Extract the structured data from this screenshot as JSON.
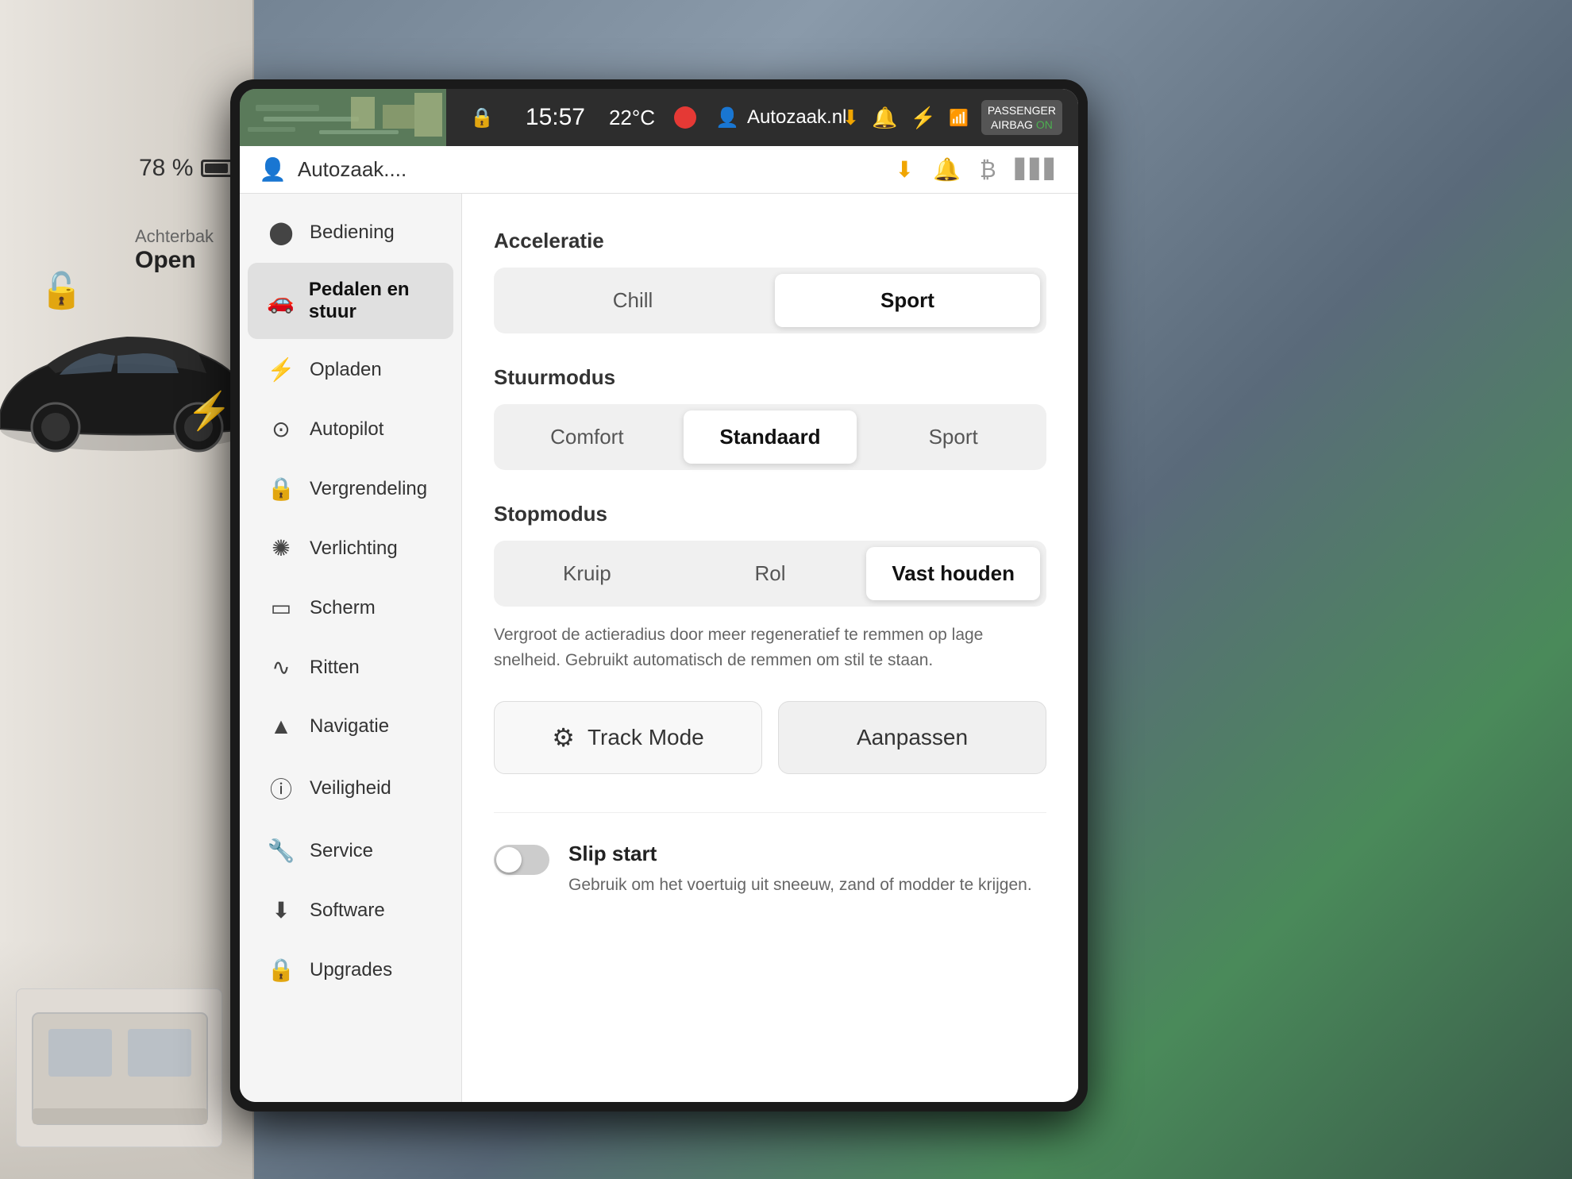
{
  "background": {
    "color": "#6a7a8a"
  },
  "car_left": {
    "battery_percent": "78 %",
    "trunk_label": "Achterbak",
    "trunk_value": "Open"
  },
  "status_bar": {
    "time": "15:57",
    "temp": "22°C",
    "nav_label": "Autozaak.nl",
    "passenger_label": "PASSENGER\nAIRBAG ON"
  },
  "user_bar": {
    "user_name": "Autozaak...."
  },
  "sidebar": {
    "items": [
      {
        "id": "bediening",
        "label": "Bediening",
        "icon": "⚙",
        "active": false
      },
      {
        "id": "pedalen",
        "label": "Pedalen en stuur",
        "icon": "🚗",
        "active": true
      },
      {
        "id": "opladen",
        "label": "Opladen",
        "icon": "⚡",
        "active": false
      },
      {
        "id": "autopilot",
        "label": "Autopilot",
        "icon": "🔘",
        "active": false
      },
      {
        "id": "vergrendeling",
        "label": "Vergrendeling",
        "icon": "🔒",
        "active": false
      },
      {
        "id": "verlichting",
        "label": "Verlichting",
        "icon": "💡",
        "active": false
      },
      {
        "id": "scherm",
        "label": "Scherm",
        "icon": "📺",
        "active": false
      },
      {
        "id": "ritten",
        "label": "Ritten",
        "icon": "🗺",
        "active": false
      },
      {
        "id": "navigatie",
        "label": "Navigatie",
        "icon": "▲",
        "active": false
      },
      {
        "id": "veiligheid",
        "label": "Veiligheid",
        "icon": "ℹ",
        "active": false
      },
      {
        "id": "service",
        "label": "Service",
        "icon": "🔧",
        "active": false
      },
      {
        "id": "software",
        "label": "Software",
        "icon": "⬇",
        "active": false
      },
      {
        "id": "upgrades",
        "label": "Upgrades",
        "icon": "🔒",
        "active": false
      }
    ]
  },
  "settings": {
    "acceleratie": {
      "title": "Acceleratie",
      "options": [
        {
          "id": "chill",
          "label": "Chill",
          "active": false
        },
        {
          "id": "sport",
          "label": "Sport",
          "active": true
        }
      ]
    },
    "stuurmodus": {
      "title": "Stuurmodus",
      "options": [
        {
          "id": "comfort",
          "label": "Comfort",
          "active": false
        },
        {
          "id": "standaard",
          "label": "Standaard",
          "active": true
        },
        {
          "id": "sport",
          "label": "Sport",
          "active": false
        }
      ]
    },
    "stopmodus": {
      "title": "Stopmodus",
      "options": [
        {
          "id": "kruip",
          "label": "Kruip",
          "active": false
        },
        {
          "id": "rol",
          "label": "Rol",
          "active": false
        },
        {
          "id": "vast_houden",
          "label": "Vast houden",
          "active": true
        }
      ],
      "description": "Vergroot de actieradius door meer regeneratief te remmen op lage snelheid. Gebruikt automatisch de remmen om stil te staan."
    },
    "track_mode": {
      "label": "Track Mode",
      "aanpassen_label": "Aanpassen"
    },
    "slip_start": {
      "title": "Slip start",
      "description": "Gebruik om het voertuig uit sneeuw, zand of modder te krijgen.",
      "enabled": false
    }
  }
}
